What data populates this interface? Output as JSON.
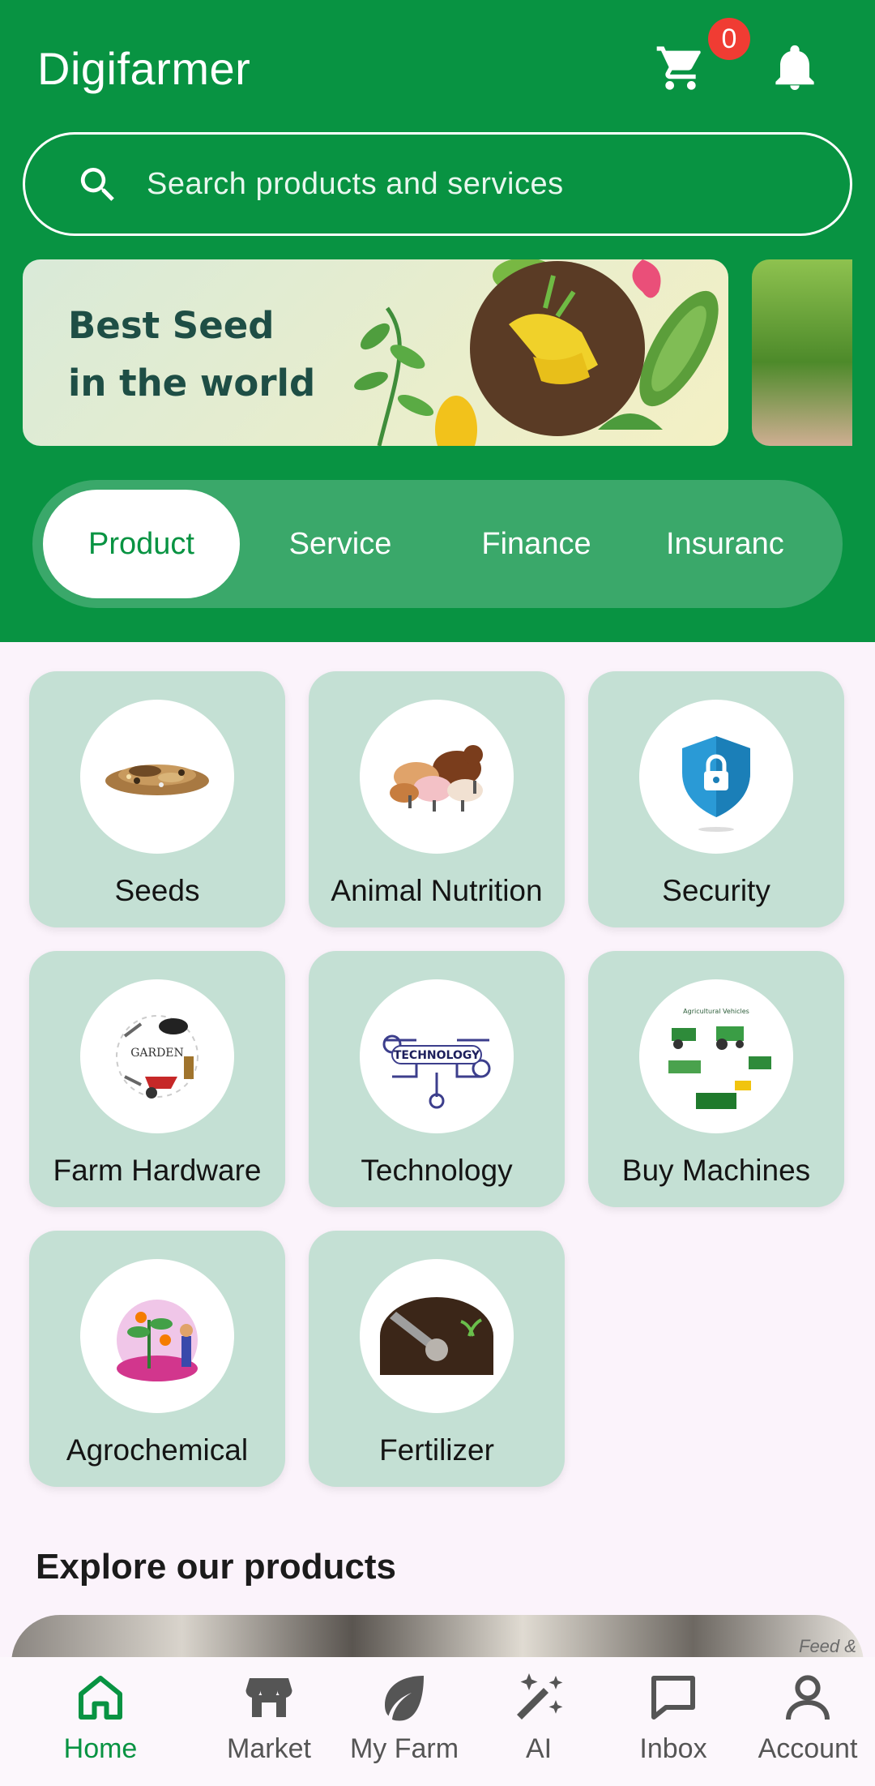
{
  "header": {
    "title": "Digifarmer",
    "cart_count": "0",
    "icons": [
      "cart-icon",
      "bell-icon"
    ]
  },
  "search": {
    "placeholder": "Search products and services",
    "icon": "search-icon"
  },
  "banner": {
    "line1": "Best Seed",
    "line2": "in the world"
  },
  "tabs": [
    {
      "label": "Product",
      "active": true
    },
    {
      "label": "Service"
    },
    {
      "label": "Finance"
    },
    {
      "label": "Insuranc"
    }
  ],
  "categories": [
    {
      "label": "Seeds"
    },
    {
      "label": "Animal Nutrition"
    },
    {
      "label": "Security"
    },
    {
      "label": "Farm Hardware",
      "badge_text": "GARDEN"
    },
    {
      "label": "Technology",
      "badge_text": "TECHNOLOGY"
    },
    {
      "label": "Buy Machines",
      "badge_text": "Agricultural Vehicles"
    },
    {
      "label": "Agrochemical"
    },
    {
      "label": "Fertilizer"
    }
  ],
  "explore": {
    "title": "Explore our products",
    "strip_text": "Feed & Ca"
  },
  "bottom_nav": [
    {
      "label": "Home",
      "icon": "home-icon",
      "active": true
    },
    {
      "label": "Market",
      "icon": "store-icon"
    },
    {
      "label": "My Farm",
      "icon": "leaf-icon"
    },
    {
      "label": "AI",
      "icon": "magic-wand-icon"
    },
    {
      "label": "Inbox",
      "icon": "chat-icon"
    },
    {
      "label": "Account",
      "icon": "person-icon"
    }
  ],
  "colors": {
    "primary": "#089342",
    "tab_track": "#3aa86a",
    "card": "#c4e0d4",
    "badge": "#f03c33",
    "background": "#fbf3fb"
  }
}
